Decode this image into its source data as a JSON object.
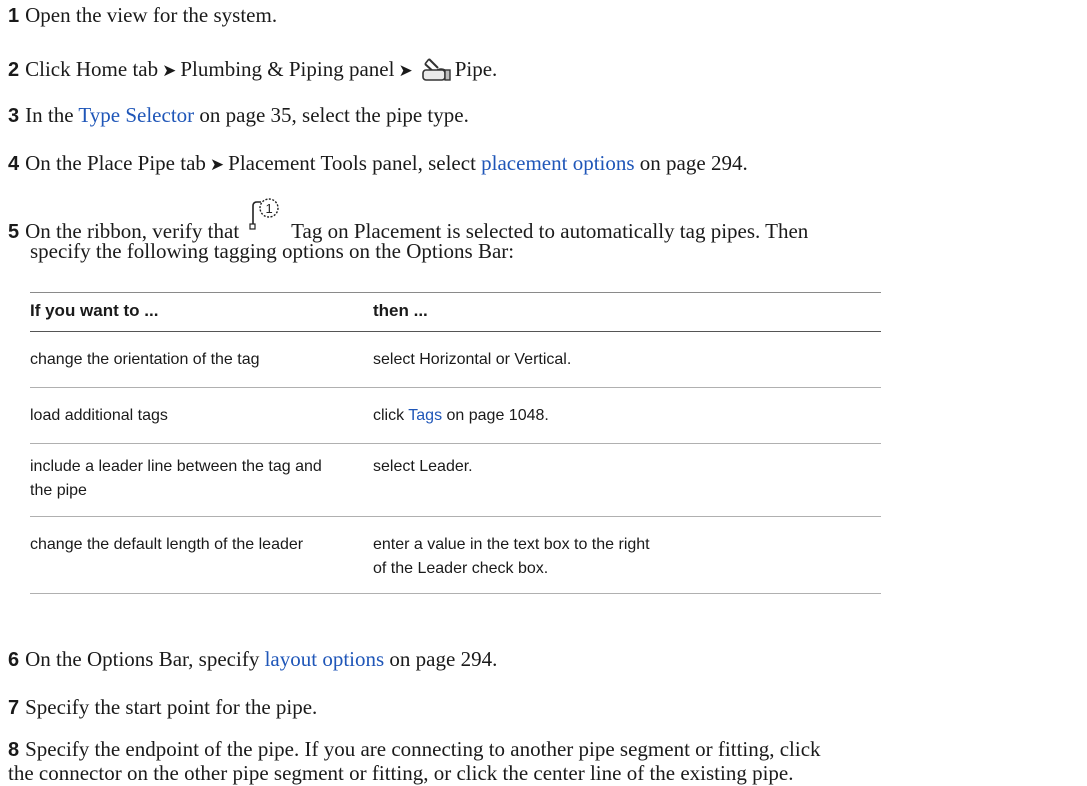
{
  "steps": [
    {
      "num": "1",
      "text": "Open the view for the system."
    },
    {
      "num": "2",
      "pre": "Click Home tab",
      "mid": "Plumbing & Piping panel",
      "post": "Pipe.",
      "arrow": "➤",
      "icon": "pipe-icon"
    },
    {
      "num": "3",
      "pre": "In the",
      "link": "Type Selector",
      "post": "on page 35, select the pipe type."
    },
    {
      "num": "4",
      "pre": "On the Place Pipe tab",
      "arrow": "➤",
      "mid": "Placement Tools panel, select",
      "link": "placement options",
      "post": "on page 294."
    },
    {
      "num": "5",
      "pre": "On the ribbon, verify that",
      "icon": "tag-on-placement-icon",
      "post": "Tag on Placement is selected to automatically tag pipes. Then",
      "line2": "specify the following tagging options on the Options Bar:"
    },
    {
      "num": "6",
      "pre": "On the Options Bar, specify",
      "link": "layout options",
      "post": "on page 294."
    },
    {
      "num": "7",
      "text": "Specify the start point for the pipe."
    },
    {
      "num": "8",
      "text": "Specify the endpoint of the pipe. If you are connecting to another pipe segment or fitting, click",
      "line2": "the connector on the other pipe segment or fitting, or click the center line of the existing pipe."
    }
  ],
  "table": {
    "headers": [
      "If you want to ...",
      "then ..."
    ],
    "rows": [
      {
        "c1": [
          "change the orientation of the tag"
        ],
        "c2": [
          "select Horizontal or Vertical."
        ]
      },
      {
        "c1": [
          "load additional tags"
        ],
        "c2_link": "Tags",
        "c2_pre": "click",
        "c2_post": "on page 1048."
      },
      {
        "c1": [
          "include a leader line between the tag and",
          "the pipe"
        ],
        "c2": [
          "select Leader."
        ]
      },
      {
        "c1": [
          "change the default length of the leader"
        ],
        "c2": [
          "enter a value in the text box to the right",
          "of the Leader check box."
        ]
      }
    ]
  },
  "colors": {
    "link": "#1f56b8",
    "text": "#1a1a1a"
  }
}
